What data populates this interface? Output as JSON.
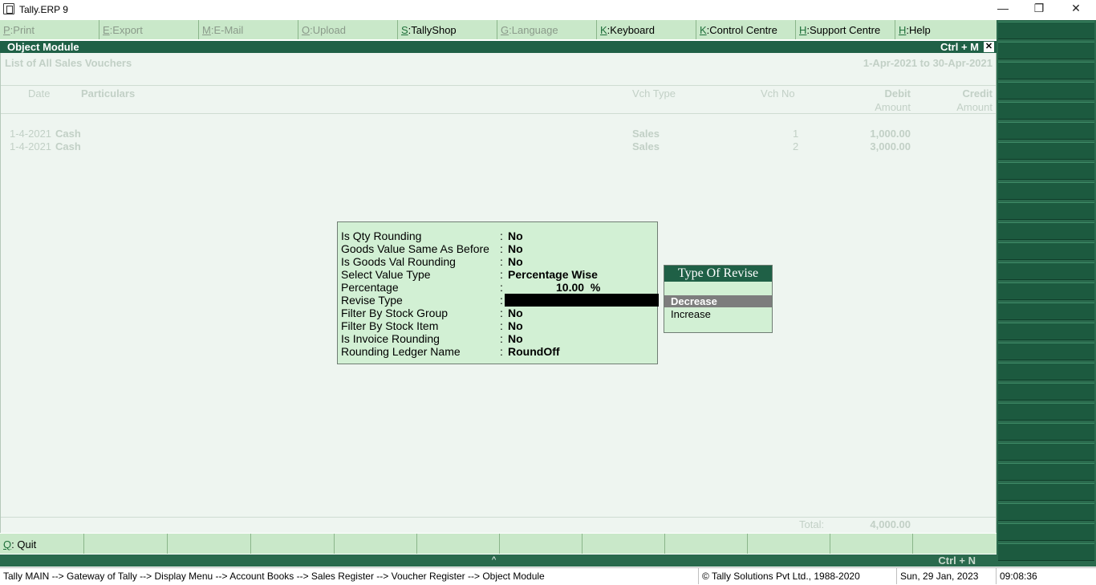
{
  "window": {
    "title": "Tally.ERP 9",
    "minimize": "—",
    "restore": "❐",
    "close": "✕"
  },
  "menubar": [
    {
      "key": "P",
      "label": "Print",
      "enabled": false
    },
    {
      "key": "E",
      "label": "Export",
      "enabled": false
    },
    {
      "key": "M",
      "label": "E-Mail",
      "enabled": false
    },
    {
      "key": "O",
      "label": "Upload",
      "enabled": false
    },
    {
      "key": "S",
      "label": "TallyShop",
      "enabled": true
    },
    {
      "key": "G",
      "label": "Language",
      "enabled": false
    },
    {
      "key": "K",
      "label": "Keyboard",
      "enabled": true
    },
    {
      "key": "K",
      "label": "Control Centre",
      "enabled": true
    },
    {
      "key": "H",
      "label": "Support Centre",
      "enabled": true
    },
    {
      "key": "H",
      "label": "Help",
      "enabled": true
    }
  ],
  "module": {
    "name": "Object Module",
    "shortcut": "Ctrl + M",
    "close": "✕"
  },
  "report": {
    "title": "List of All Sales Vouchers",
    "period": "1-Apr-2021 to 30-Apr-2021",
    "columns": {
      "date": "Date",
      "particulars": "Particulars",
      "vch_type": "Vch Type",
      "vch_no": "Vch No",
      "debit": "Debit",
      "debit_sub": "Amount",
      "credit": "Credit",
      "credit_sub": "Amount"
    },
    "rows": [
      {
        "date": "1-4-2021",
        "particulars": "Cash",
        "vch_type": "Sales",
        "vch_no": "1",
        "debit": "1,000.00"
      },
      {
        "date": "1-4-2021",
        "particulars": "Cash",
        "vch_type": "Sales",
        "vch_no": "2",
        "debit": "3,000.00"
      }
    ],
    "total_label": "Total:",
    "total_value": "4,000.00"
  },
  "form": {
    "rows": [
      {
        "label": "Is Qty Rounding",
        "value": "No"
      },
      {
        "label": "Goods Value Same As Before",
        "value": "No"
      },
      {
        "label": "Is Goods Val Rounding",
        "value": "No"
      },
      {
        "label": "Select Value Type",
        "value": "Percentage Wise"
      },
      {
        "label": "Percentage",
        "value": "10.00  %"
      },
      {
        "label": "Revise Type",
        "value": ""
      },
      {
        "label": "Filter By Stock Group",
        "value": "No"
      },
      {
        "label": "Filter By Stock Item",
        "value": "No"
      },
      {
        "label": "Is Invoice Rounding",
        "value": "No"
      },
      {
        "label": "Rounding Ledger Name",
        "value": "RoundOff"
      }
    ],
    "colon": ":"
  },
  "popup": {
    "title": "Type Of Revise",
    "options": [
      "Decrease",
      "Increase"
    ],
    "selected": "Decrease"
  },
  "bottombar": {
    "quit_key": "Q",
    "quit_label": "Quit",
    "ctrl_n": "Ctrl + N",
    "scroll_up": "^"
  },
  "statusbar": {
    "breadcrumb": "Tally MAIN --> Gateway of Tally --> Display Menu --> Account Books --> Sales Register --> Voucher Register --> Object Module",
    "copyright": "© Tally Solutions Pvt Ltd., 1988-2020",
    "date": "Sun, 29 Jan, 2023",
    "time": "09:08:36"
  }
}
